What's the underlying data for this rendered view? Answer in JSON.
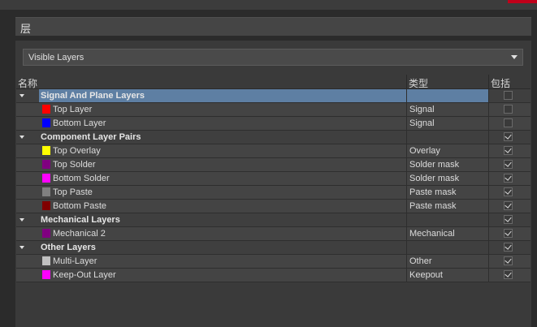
{
  "section_title": "层",
  "dropdown": {
    "value": "Visible Layers"
  },
  "headers": {
    "name": "名称",
    "type": "类型",
    "include": "包括"
  },
  "rows": [
    {
      "kind": "group",
      "name": "Signal And Plane Layers",
      "type": "",
      "checked": false,
      "selected": true
    },
    {
      "kind": "layer",
      "name": "Top Layer",
      "type": "Signal",
      "color": "#ff0000",
      "checked": false
    },
    {
      "kind": "layer",
      "name": "Bottom Layer",
      "type": "Signal",
      "color": "#0000ff",
      "checked": false
    },
    {
      "kind": "group",
      "name": "Component Layer Pairs",
      "type": "",
      "checked": true
    },
    {
      "kind": "layer",
      "name": "Top Overlay",
      "type": "Overlay",
      "color": "#ffff00",
      "checked": true
    },
    {
      "kind": "layer",
      "name": "Top Solder",
      "type": "Solder mask",
      "color": "#800080",
      "checked": true
    },
    {
      "kind": "layer",
      "name": "Bottom Solder",
      "type": "Solder mask",
      "color": "#ff00ff",
      "checked": true
    },
    {
      "kind": "layer",
      "name": "Top Paste",
      "type": "Paste mask",
      "color": "#808080",
      "checked": true
    },
    {
      "kind": "layer",
      "name": "Bottom Paste",
      "type": "Paste mask",
      "color": "#800000",
      "checked": true
    },
    {
      "kind": "group",
      "name": "Mechanical Layers",
      "type": "",
      "checked": true
    },
    {
      "kind": "layer",
      "name": "Mechanical 2",
      "type": "Mechanical",
      "color": "#800080",
      "checked": true
    },
    {
      "kind": "group",
      "name": "Other Layers",
      "type": "",
      "checked": true
    },
    {
      "kind": "layer",
      "name": "Multi-Layer",
      "type": "Other",
      "color": "#c0c0c0",
      "checked": true
    },
    {
      "kind": "layer",
      "name": "Keep-Out Layer",
      "type": "Keepout",
      "color": "#ff00ff",
      "checked": true
    }
  ]
}
